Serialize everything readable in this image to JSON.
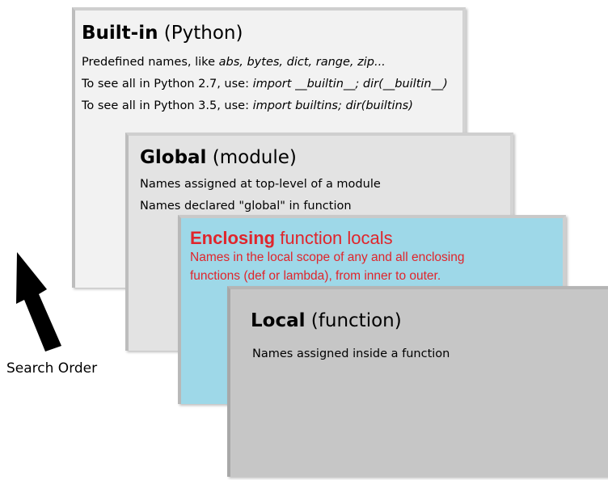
{
  "builtin": {
    "title_bold": "Built-in",
    "title_rest": " (Python)",
    "line1_plain": "Predefined names, like ",
    "line1_italic": "abs, bytes, dict, range, zip...",
    "line2_plain": "To see all in Python 2.7, use: ",
    "line2_italic": "import __builtin__; dir(__builtin__)",
    "line3_plain": "To see all in Python 3.5, use: ",
    "line3_italic": "import builtins; dir(builtins)"
  },
  "global": {
    "title_bold": "Global",
    "title_rest": " (module)",
    "line1": "Names assigned at top-level of a module",
    "line2": "Names declared \"global\" in function"
  },
  "enclosing": {
    "title_bold": "Enclosing",
    "title_rest": " function locals",
    "line1": "Names in the local scope of any and all enclosing",
    "line2": "functions (def or lambda), from inner to outer."
  },
  "local": {
    "title_bold": "Local",
    "title_rest": " (function)",
    "line1": "Names assigned inside a function"
  },
  "arrow_label": "Search Order",
  "colors": {
    "builtin_bg": "#f2f2f2",
    "global_bg": "#e3e3e3",
    "enclosing_bg": "#9ed8e8",
    "enclosing_text": "#e0252b",
    "local_bg": "#c6c6c6"
  }
}
